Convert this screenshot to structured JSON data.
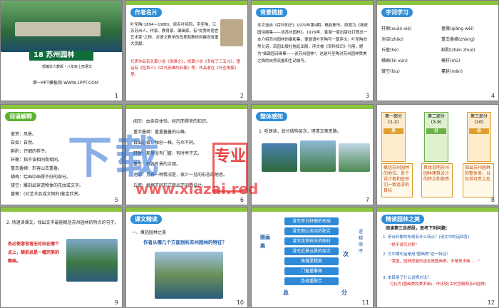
{
  "slides": {
    "s1": {
      "title": "18 苏州园林",
      "subtitle": "部编本人教版・八年级上册语文",
      "footer": "第一PPT模板网-WWW.1PPT.COM",
      "num": "1"
    },
    "s2": {
      "header": "作者名片",
      "text1": "叶圣陶(1894—1988)，原名叶绍钧，字圣陶，江苏苏州人。作家、教育家、编辑家。有\"优秀的语言艺术家\"之称，对语文教学的改革和教材的建设有重大贡献。",
      "text2": "代表作品有长篇小说《倪焕之》，短篇小说《多收了三五斗》，童话有《稻草人》《古代英雄的石像》等，作品收在《叶圣陶集》里。",
      "num": "2"
    },
    "s3": {
      "header": "背景链接",
      "text": "本文选自《百科知识》1979年第4期。略有删节。原题为《拙政园诗画集——谈苏州园林》。1979年，香港一家出版社打算出一本介绍苏州园林的摄影集，便邀请叶圣陶写一篇序文。叶圣陶欣然允诺。后因出版社拖延出版，序文被《百科知识》刊用，题为\"拙政园诗画集——谈苏州园林\"，这是叶圣陶对苏州园林赞美之情的自然流露和生动描写。",
      "num": "3"
    },
    "s4": {
      "header": "字词学习",
      "words": [
        "轩榭(xuān xiè)",
        "池沼(zhǎo)",
        "丘壑(hè)",
        "嶙峋(lín xún)",
        "镂空(lòu)",
        "蔷薇(qiáng wēi)",
        "重峦叠嶂(zhàng)",
        "斟酌(zhēn zhuó)",
        "模样(mú)",
        "蔓延(màn)"
      ],
      "num": "4"
    },
    "s5": {
      "header": "词语解释",
      "items": [
        "鉴赏：风景。",
        "自如：自然。",
        "斟酌：仔细的样子。",
        "轩榭：指不该相同而相同。",
        "重峦叠嶂：形容山峦重叠。",
        "嶙峋：绘画中画得不好的部分。",
        "镂空：雕刻出穿透物体的花纹或文字。",
        "蔷薇：(对艺术品或文物的)鉴定欣赏。"
      ],
      "num": "5"
    },
    "s6": {
      "items": [
        "阅历：由亲自体验、经历而得来的知识。",
        "重峦叠嶂：重重叠叠的山峰。",
        "自出心裁：独创一格，与众不同。",
        "轩榭：那里没有门窗，有时亭子式。",
        "重峦：形容有景的点缀。",
        "池沼：另有一种情况是，很少一见的形态的地思。",
        "丘壑：根据不同形式做出不同的设计。"
      ],
      "num": "6"
    },
    "s7": {
      "header": "整体感知",
      "prompt": "1. 听朗读，划分结构层次，理清文章思路。",
      "num": "7"
    },
    "s8": {
      "parts": [
        {
          "title": "第一部分",
          "range": "(1-2)",
          "tag": "总",
          "desc": "概括苏州园林的地位、各个设计者和匠师们一致追求的目标"
        },
        {
          "title": "第二部分",
          "range": "(3-9)",
          "tag": "分",
          "desc": "具体说明苏州园林建筑设计的特点和美感"
        },
        {
          "title": "第三部分",
          "range": "(10)",
          "tag": "总",
          "desc": "指出苏州园林的整体美，以及其可贵之处"
        }
      ],
      "num": "8"
    },
    "s9": {
      "prompt": "2. 快速读课文，找出文中最能概括苏州园林的特点的句子。",
      "answer": "务必使游览者无论站在哪个点上，眼前总是一幅完美的图画。",
      "num": "9"
    },
    "s10": {
      "header": "课文精读",
      "section": "一、概括园林之美",
      "question": "作者从哪几个方面剖析苏州园林的特征？",
      "num": "10"
    },
    "s11": {
      "items": [
        "讲究亭台轩榭的布局",
        "讲究假山池沼的配合",
        "讲究花草树木的映衬",
        "讲究近景远景的层次",
        "角落里精美",
        "门窗重雕琢",
        "色调重配合"
      ],
      "left": "图画美",
      "right": "逻辑顺序",
      "bottom_left": "总",
      "bottom_right": "分",
      "mid": "次",
      "num": "11"
    },
    "s12": {
      "header": "精读园林之美",
      "intro": "阅读第三自然段，思考下列问题：",
      "q1": "1. 亭台轩榭的布局有什么特点？(用文中的话回答)",
      "a1": "\"绝不讲究对称\"",
      "q2": "2. 文中哪句话是用\"图画美\"这一特征？",
      "a2": "\"我国，园林房屋的选址是图画美，不是美术画……\"",
      "q3": "3. 本段用了什么说明方法？",
      "a3": "打比方(图画美和美术画)，作比较(古代宫殿和苏州园林)",
      "num": "12"
    }
  },
  "watermark": {
    "big": "下载",
    "seal": "专业",
    "url": "www.xiazai.red"
  },
  "colors": {
    "accent_blue": "#2f8ed8",
    "accent_green": "#8cc63f",
    "red_text": "#d21d1d"
  }
}
